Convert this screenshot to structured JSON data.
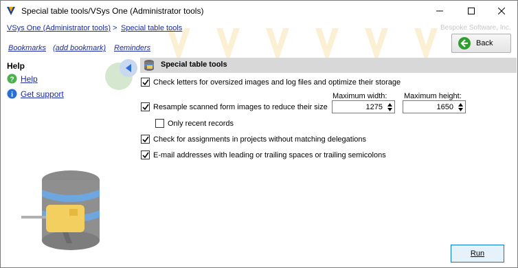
{
  "window": {
    "title": "Special table tools/VSys One (Administrator tools)",
    "brand": "Bespoke Software, Inc."
  },
  "breadcrumb": {
    "root": "VSys One (Administrator tools)",
    "separator": ">",
    "current": "Special table tools"
  },
  "links": {
    "bookmarks": "Bookmarks",
    "add_bookmark": "(add bookmark)",
    "reminders": "Reminders"
  },
  "back_button": {
    "label": "Back"
  },
  "help": {
    "title": "Help",
    "help_link": "Help",
    "support_link": "Get support"
  },
  "section": {
    "title": "Special table tools"
  },
  "options": {
    "oversized": {
      "label": "Check letters for oversized images and log files and optimize their storage",
      "checked": true
    },
    "resample": {
      "label": "Resample scanned form images to reduce their size",
      "checked": true
    },
    "only_recent": {
      "label": "Only recent records",
      "checked": false
    },
    "assignments": {
      "label": "Check for assignments in projects without matching delegations",
      "checked": true
    },
    "email": {
      "label": "E-mail addresses with leading or trailing spaces or trailing semicolons",
      "checked": true
    }
  },
  "resample_settings": {
    "max_width_label": "Maximum width:",
    "max_width": "1275",
    "max_height_label": "Maximum height:",
    "max_height": "1650"
  },
  "run_button": {
    "label": "Run"
  },
  "colors": {
    "link": "#1a2aa6",
    "section_bar": "#d8d8d8",
    "accent_blue": "#0078d7",
    "back_arrow_green": "#2e9e2e"
  }
}
